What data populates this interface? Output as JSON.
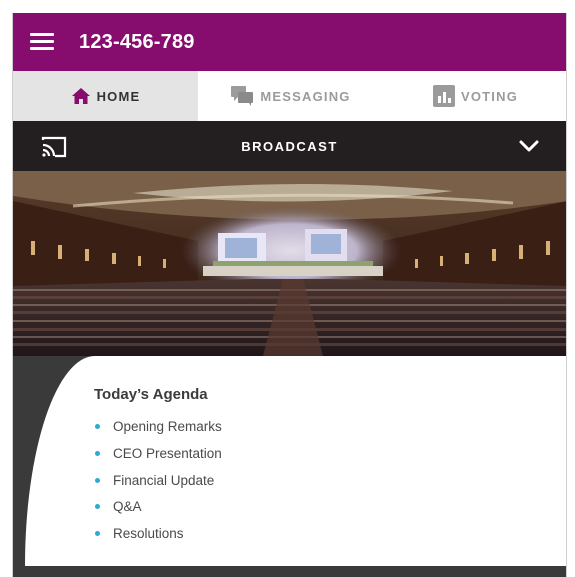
{
  "header": {
    "phone_number": "123-456-789",
    "background_color": "#860d6e",
    "menu_icon": "hamburger-menu-icon"
  },
  "tabs": [
    {
      "label": "HOME",
      "icon": "home-icon",
      "active": true,
      "color": "#860d6e"
    },
    {
      "label": "MESSAGING",
      "icon": "chat-icon",
      "active": false
    },
    {
      "label": "VOTING",
      "icon": "bar-chart-icon",
      "active": false
    }
  ],
  "broadcast": {
    "label": "BROADCAST",
    "cast_icon": "cast-icon",
    "toggle_icon": "chevron-down-icon"
  },
  "hero_image": {
    "subject": "conference-hall-audience"
  },
  "agenda": {
    "title": "Today’s Agenda",
    "bullet_color": "#2ea8d6",
    "items": [
      "Opening Remarks",
      "CEO Presentation",
      "Financial Update",
      "Q&A",
      "Resolutions"
    ]
  }
}
